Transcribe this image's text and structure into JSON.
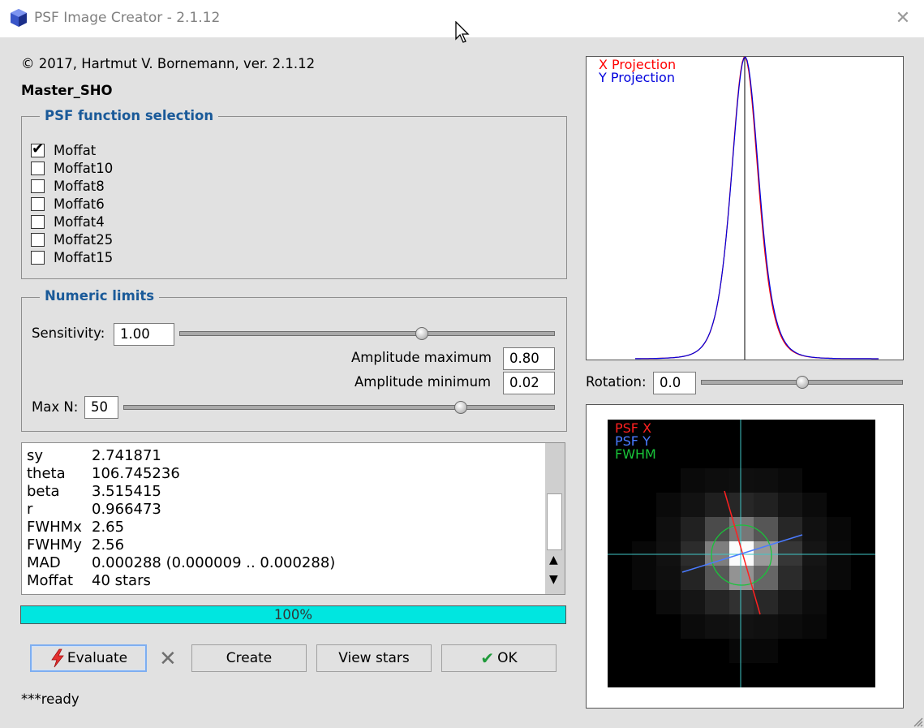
{
  "window": {
    "title": "PSF Image Creator - 2.1.12",
    "close_glyph": "✕"
  },
  "header": {
    "copyright": "© 2017, Hartmut V. Bornemann, ver. 2.1.12",
    "image_name": "Master_SHO"
  },
  "psf_group": {
    "title": "PSF function selection",
    "options": [
      {
        "label": "Moffat",
        "checked": true
      },
      {
        "label": "Moffat10",
        "checked": false
      },
      {
        "label": "Moffat8",
        "checked": false
      },
      {
        "label": "Moffat6",
        "checked": false
      },
      {
        "label": "Moffat4",
        "checked": false
      },
      {
        "label": "Moffat25",
        "checked": false
      },
      {
        "label": "Moffat15",
        "checked": false
      }
    ]
  },
  "numeric": {
    "title": "Numeric limits",
    "sensitivity_label": "Sensitivity:",
    "sensitivity_value": "1.00",
    "sensitivity_slider_fraction": 0.65,
    "amp_max_label": "Amplitude maximum",
    "amp_max_value": "0.80",
    "amp_min_label": "Amplitude minimum",
    "amp_min_value": "0.02",
    "maxn_label": "Max N:",
    "maxn_value": "50",
    "maxn_slider_fraction": 0.79
  },
  "results": [
    {
      "key": "sy",
      "value": "2.741871"
    },
    {
      "key": "theta",
      "value": "106.745236"
    },
    {
      "key": "beta",
      "value": "3.515415"
    },
    {
      "key": "r",
      "value": "0.966473"
    },
    {
      "key": "FWHMx",
      "value": "2.65"
    },
    {
      "key": "FWHMy",
      "value": "2.56"
    },
    {
      "key": "MAD",
      "value": "0.000288 (0.000009 .. 0.000288)"
    },
    {
      "key": "Moffat",
      "value": "40 stars"
    }
  ],
  "progress": {
    "percent": 100,
    "label": "100%"
  },
  "buttons": {
    "evaluate": "Evaluate",
    "create": "Create",
    "view_stars": "View stars",
    "ok": "OK"
  },
  "status": "***ready",
  "projection": {
    "x_label": "X Projection",
    "y_label": "Y Projection",
    "x_color": "#ff0000",
    "y_color": "#0000dd"
  },
  "rotation": {
    "label": "Rotation:",
    "value": "0.0",
    "slider_fraction": 0.5
  },
  "psf_image": {
    "x_label": "PSF X",
    "y_label": "PSF Y",
    "fwhm_label": "FWHM",
    "x_color": "#ff2020",
    "y_color": "#4a7bff",
    "fwhm_color": "#19c43a"
  }
}
